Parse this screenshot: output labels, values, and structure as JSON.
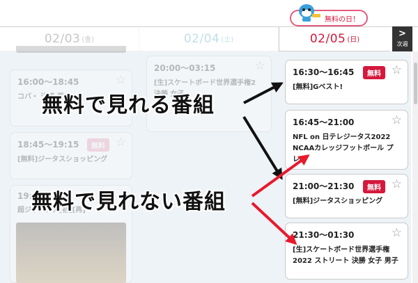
{
  "header": {
    "days": [
      {
        "date": "02/03",
        "dow": "(金)"
      },
      {
        "date": "02/04",
        "dow": "(土)"
      },
      {
        "date": "02/05",
        "dow": "(日)"
      }
    ],
    "next_week_label": "次週",
    "free_day_badge": "無料の日！"
  },
  "col0": {
    "cards": [
      {
        "time": "16:00〜18:45",
        "title": "コバ・ 決勝 業"
      },
      {
        "time": "18:45〜19:15",
        "title": "[無料]ジータスショッピング",
        "tag": "無料"
      },
      {
        "time": "19:",
        "title": "超ジャアアア[初][再]"
      }
    ]
  },
  "col1": {
    "cards": [
      {
        "time": "20:00〜03:15",
        "title": "[生]スケートボード世界選手権2 決勝 女子"
      }
    ]
  },
  "col2": {
    "cards": [
      {
        "time": "16:30〜16:45",
        "title": "[無料]Gベスト!",
        "tag": "無料"
      },
      {
        "time": "16:45〜21:00",
        "title": "NFL on 日テレジータス2022 NCAAカレッジフットボール プレ…"
      },
      {
        "time": "21:00〜21:30",
        "title": "[無料]ジータスショッピング",
        "tag": "無料"
      },
      {
        "time": "21:30〜01:30",
        "title": "[生]スケートボード世界選手権2022 ストリート 決勝 女子 男子"
      }
    ]
  },
  "annotations": {
    "free_label": "無料で見れる番組",
    "not_free_label": "無料で見れない番組"
  },
  "colors": {
    "accent_red": "#d5193d",
    "sat_blue": "#1a8fb8"
  }
}
